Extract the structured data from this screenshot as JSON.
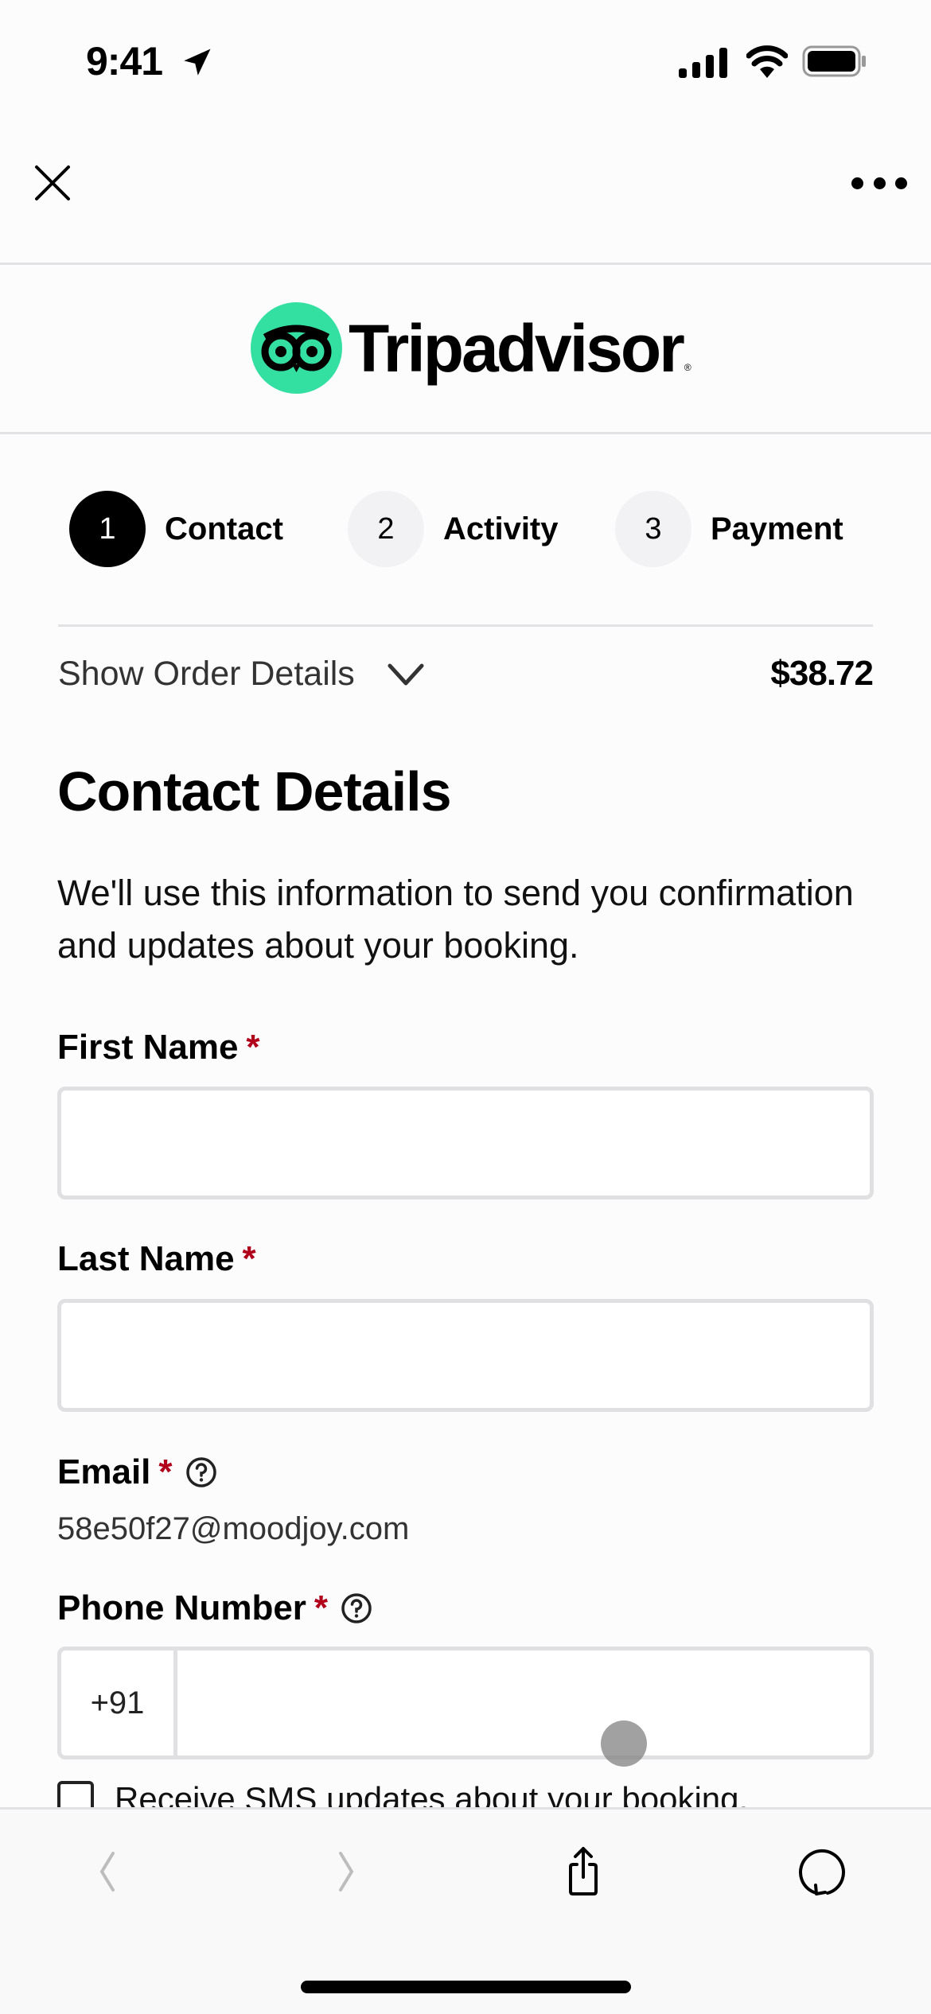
{
  "status_bar": {
    "time": "9:41"
  },
  "nav": {
    "close_label": "Close",
    "more_label": "More"
  },
  "logo": {
    "brand": "Tripadvisor",
    "accent": "#34e0a1"
  },
  "stepper": {
    "steps": [
      {
        "number": "1",
        "label": "Contact",
        "state": "active"
      },
      {
        "number": "2",
        "label": "Activity",
        "state": "inactive"
      },
      {
        "number": "3",
        "label": "Payment",
        "state": "inactive"
      }
    ]
  },
  "order": {
    "toggle_label": "Show Order Details",
    "total": "$38.72"
  },
  "contact": {
    "heading": "Contact Details",
    "intro": "We'll use this information to send you confirmation and updates about your booking.",
    "required_mark": "*",
    "required_color": "#b0001a",
    "first_name": {
      "label": "First Name",
      "value": "",
      "placeholder": ""
    },
    "last_name": {
      "label": "Last Name",
      "value": "",
      "placeholder": ""
    },
    "email": {
      "label": "Email",
      "value": "58e50f27@moodjoy.com"
    },
    "phone": {
      "label": "Phone Number",
      "country_code": "+91",
      "value": "",
      "placeholder": ""
    },
    "sms_opt_in": {
      "label": "Receive SMS updates about your booking.",
      "checked": false
    }
  },
  "toolbar": {
    "back_label": "Back",
    "forward_label": "Forward",
    "share_label": "Share",
    "reload_label": "Reload"
  }
}
